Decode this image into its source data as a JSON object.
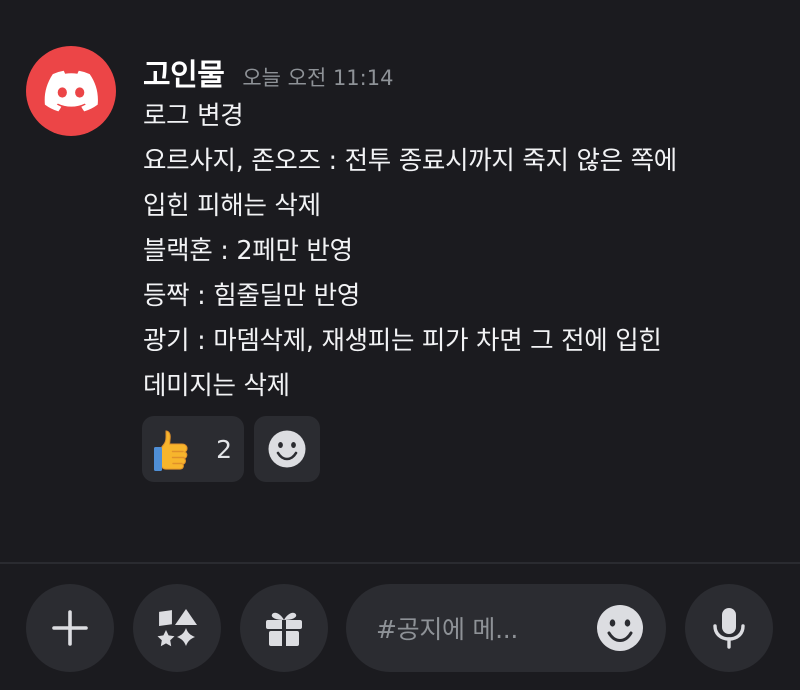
{
  "message": {
    "author": "고인물",
    "timestamp": "오늘 오전 11:14",
    "lines": [
      "로그 변경",
      "요르사지, 존오즈 : 전투 종료시까지 죽지 않은 쪽에",
      "입힌 피해는 삭제",
      "블랙혼 : 2페만 반영",
      "등짝 : 힘줄딜만 반영",
      "광기 : 마뎀삭제, 재생피는 피가 차면 그 전에 입힌",
      "데미지는 삭제"
    ],
    "reactions": [
      {
        "icon": "thumbs-up-icon",
        "count": "2"
      },
      {
        "icon": "add-reaction-icon"
      }
    ]
  },
  "composer": {
    "placeholder": "#공지에 메...",
    "buttons": [
      "plus-icon",
      "apps-icon",
      "gift-icon",
      "emoji-icon",
      "microphone-icon"
    ]
  },
  "colors": {
    "background": "#1b1b1f",
    "avatar": "#ec4547",
    "surface": "#2b2c31",
    "muted_text": "#8e9297"
  }
}
